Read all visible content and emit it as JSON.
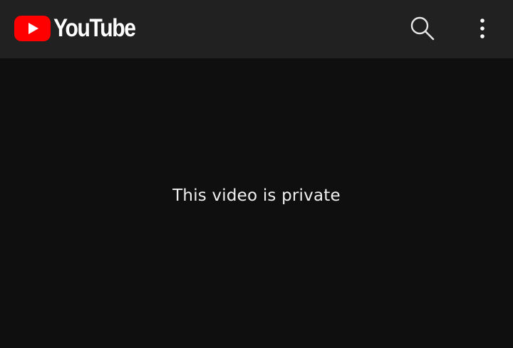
{
  "header": {
    "logo_text": "YouTube",
    "logo_icon": "youtube-play-icon",
    "search_icon": "search-icon",
    "menu_icon": "more-vertical-icon"
  },
  "player": {
    "message": "This video is private"
  },
  "colors": {
    "brand_red": "#ff0000",
    "header_bg": "#212121",
    "page_bg": "#0f0f0f",
    "text": "#f1f1f1"
  }
}
